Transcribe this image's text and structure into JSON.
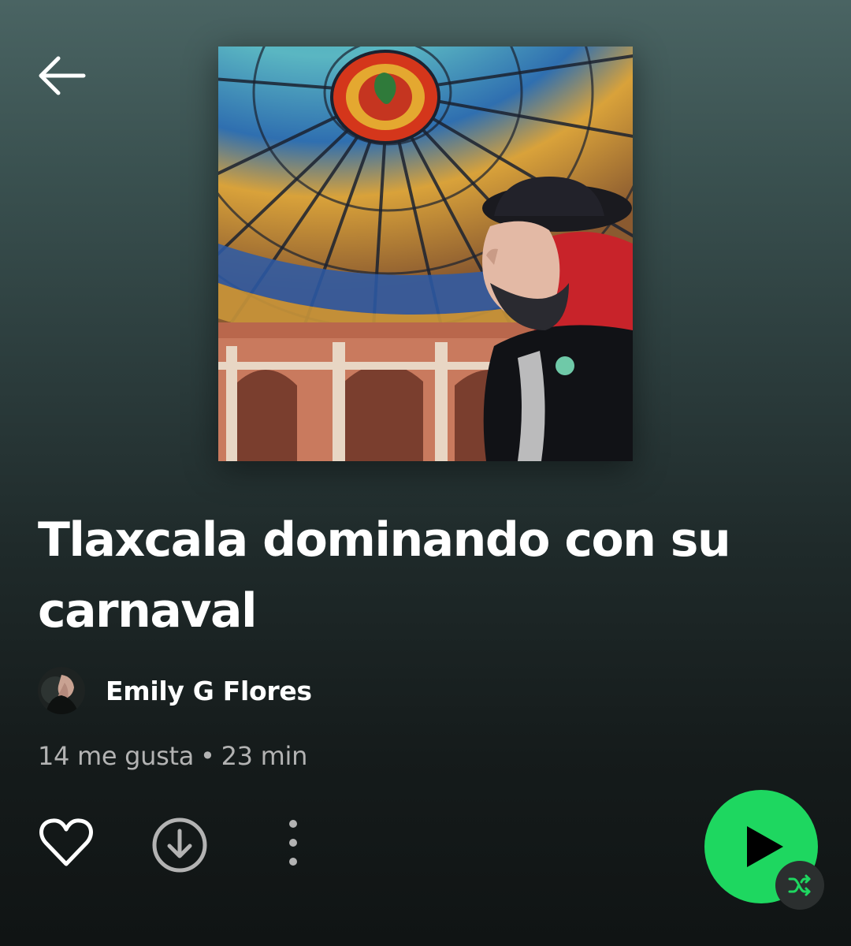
{
  "nav": {
    "back_icon": "arrow-left-icon"
  },
  "playlist": {
    "title": "Tlaxcala dominando con su carnaval",
    "owner": "Emily G Flores",
    "likes": "14 me gusta",
    "separator": "•",
    "duration": "23 min"
  },
  "actions": {
    "like_icon": "heart-outline-icon",
    "download_icon": "download-circle-icon",
    "more_icon": "more-vertical-icon",
    "play_icon": "play-icon",
    "shuffle_icon": "shuffle-icon"
  },
  "colors": {
    "accent": "#1ed760",
    "text_primary": "#ffffff",
    "text_secondary": "#b3b3b3",
    "shuffle_badge": "#2b2f2f",
    "shuffle_icon": "#1ed760"
  }
}
